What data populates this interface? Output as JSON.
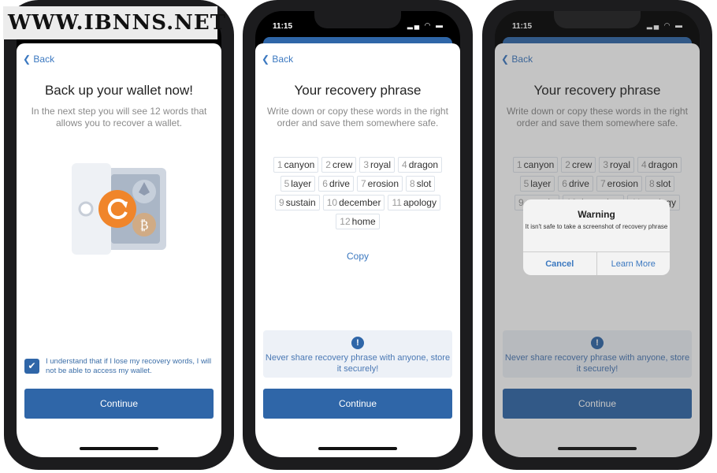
{
  "watermark": "WWW.IBNNS.NET",
  "status": {
    "time": "11:15",
    "icons": "signal wifi battery"
  },
  "screen1": {
    "back": "Back",
    "title": "Back up your wallet now!",
    "subtitle": "In the next step you will see 12 words that allows you to recover a wallet.",
    "checkbox_checked": true,
    "checkbox_label": "I understand that if I lose my recovery words, I will not be able to access my wallet.",
    "continue": "Continue"
  },
  "screen2": {
    "back": "Back",
    "title": "Your recovery phrase",
    "subtitle": "Write down or copy these words in the right order and save them somewhere safe.",
    "copy": "Copy",
    "notice": "Never share recovery phrase with anyone, store it securely!",
    "continue": "Continue"
  },
  "words": [
    {
      "n": "1",
      "w": "canyon"
    },
    {
      "n": "2",
      "w": "crew"
    },
    {
      "n": "3",
      "w": "royal"
    },
    {
      "n": "4",
      "w": "dragon"
    },
    {
      "n": "5",
      "w": "layer"
    },
    {
      "n": "6",
      "w": "drive"
    },
    {
      "n": "7",
      "w": "erosion"
    },
    {
      "n": "8",
      "w": "slot"
    },
    {
      "n": "9",
      "w": "sustain"
    },
    {
      "n": "10",
      "w": "december"
    },
    {
      "n": "11",
      "w": "apology"
    },
    {
      "n": "12",
      "w": "home"
    }
  ],
  "screen3": {
    "back": "Back",
    "title": "Your recovery phrase",
    "subtitle": "Write down or copy these words in the right order and save them somewhere safe.",
    "notice": "Never share recovery phrase with anyone, store it securely!",
    "continue": "Continue",
    "dialog": {
      "title": "Warning",
      "message": "It isn't safe to take a screenshot of recovery phrase",
      "cancel": "Cancel",
      "learn_more": "Learn More"
    }
  },
  "colors": {
    "accent": "#2f66a8",
    "refresh_badge": "#f0852a"
  }
}
